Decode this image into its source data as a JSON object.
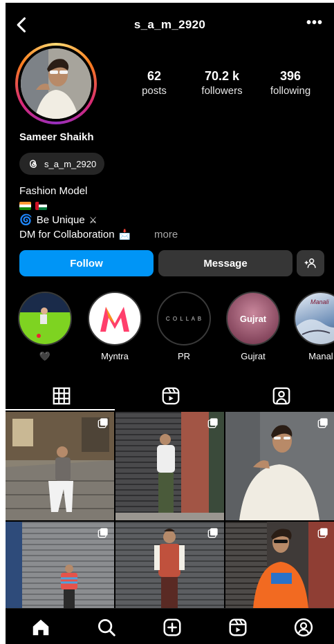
{
  "header": {
    "username": "s_a_m_2920",
    "back_icon": "chevron-left-icon",
    "more_icon": "more-dots-icon",
    "more_glyph": "•••"
  },
  "profile": {
    "stats": [
      {
        "value": "62",
        "label": "posts"
      },
      {
        "value": "70.2 k",
        "label": "followers"
      },
      {
        "value": "396",
        "label": "following"
      }
    ],
    "display_name": "Sameer Shaikh",
    "threads_handle": "s_a_m_2920",
    "bio": {
      "line1": "Fashion Model",
      "line3": "Be Unique",
      "line4": "DM for Collaboration",
      "more": "more"
    }
  },
  "actions": {
    "follow": "Follow",
    "message": "Message",
    "add_user_glyph": "+ዴ"
  },
  "highlights": [
    {
      "label": "🖤"
    },
    {
      "label": "Myntra"
    },
    {
      "label": "PR",
      "cover_text": "C O L L A B"
    },
    {
      "label": "Gujrat",
      "cover_text": "Gujrat"
    },
    {
      "label": "Manal",
      "cover_text": "Manali"
    }
  ],
  "colors": {
    "accent": "#0095f6",
    "button_dark": "#363636",
    "background": "#000000"
  },
  "nav": [
    "home-icon",
    "search-icon",
    "create-icon",
    "reels-icon",
    "profile-icon"
  ]
}
